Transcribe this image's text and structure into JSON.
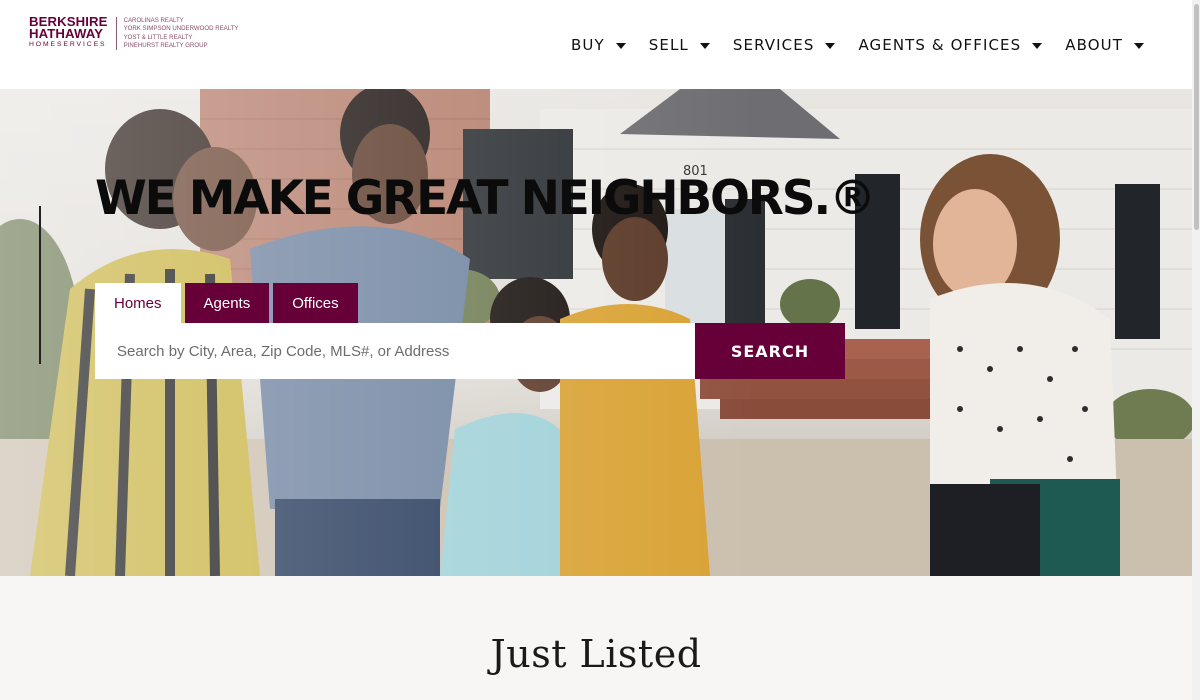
{
  "brand": {
    "line1": "BERKSHIRE",
    "line2": "HATHAWAY",
    "line3": "HOMESERVICES",
    "affiliates": [
      "CAROLINAS REALTY",
      "YORK SIMPSON UNDERWOOD REALTY",
      "YOST & LITTLE REALTY",
      "PINEHURST REALTY GROUP"
    ],
    "color": "#670038"
  },
  "nav": {
    "items": [
      {
        "label": "BUY",
        "icon": "caret-down-icon"
      },
      {
        "label": "SELL",
        "icon": "caret-down-icon"
      },
      {
        "label": "SERVICES",
        "icon": "caret-down-icon"
      },
      {
        "label": "AGENTS & OFFICES",
        "icon": "caret-down-icon"
      },
      {
        "label": "ABOUT",
        "icon": "caret-down-icon"
      }
    ]
  },
  "hero": {
    "headline": "WE MAKE GREAT NEIGHBORS.®",
    "tabs": [
      "Homes",
      "Agents",
      "Offices"
    ],
    "active_tab": "Homes",
    "search_placeholder": "Search by City, Area, Zip Code, MLS#, or Address",
    "search_value": "",
    "search_button": "SEARCH",
    "house_number": "801"
  },
  "section": {
    "title": "Just Listed"
  },
  "colors": {
    "accent": "#670038",
    "section_bg": "#f7f6f4"
  }
}
